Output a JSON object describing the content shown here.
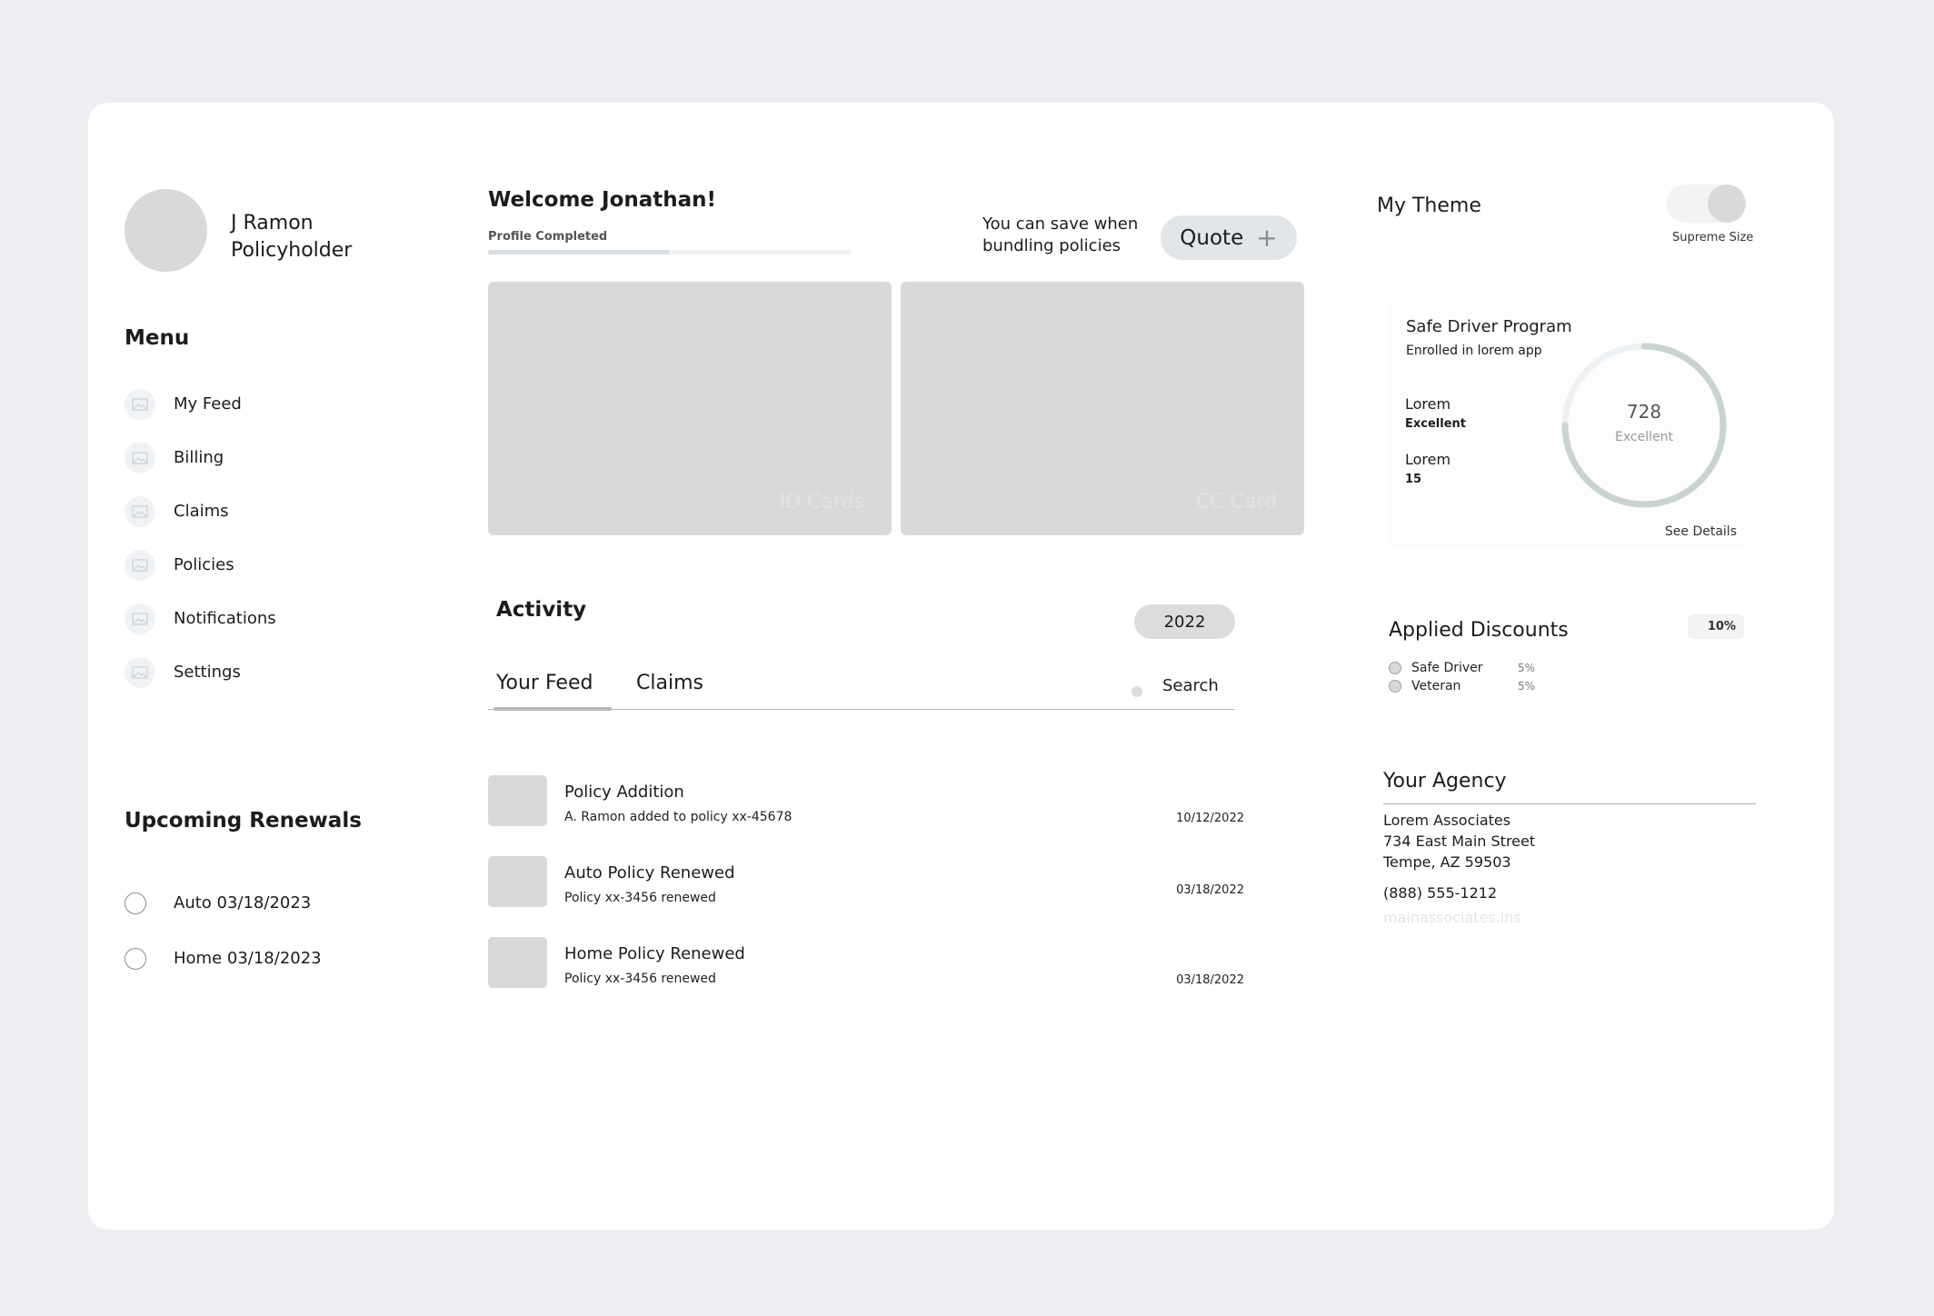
{
  "profile": {
    "name": "J Ramon",
    "role": "Policyholder"
  },
  "menu": {
    "heading": "Menu",
    "items": [
      {
        "label": "My Feed",
        "icon": "image-icon"
      },
      {
        "label": "Billing",
        "icon": "image-icon"
      },
      {
        "label": "Claims",
        "icon": "image-icon"
      },
      {
        "label": "Policies",
        "icon": "image-icon"
      },
      {
        "label": "Notifications",
        "icon": "image-icon"
      },
      {
        "label": "Settings",
        "icon": "image-icon"
      }
    ]
  },
  "renewals": {
    "heading": "Upcoming Renewals",
    "items": [
      "Auto 03/18/2023",
      "Home 03/18/2023"
    ]
  },
  "welcome": {
    "title": "Welcome Jonathan!",
    "progress_label": "Profile Completed",
    "progress_fraction": 0.5
  },
  "bundle": {
    "text": "You can save when bundling policies",
    "quote_label": "Quote",
    "quote_icon": "plus-icon"
  },
  "cards": [
    {
      "label": "ID Cards"
    },
    {
      "label": "CC Card"
    }
  ],
  "activity": {
    "heading": "Activity",
    "year": "2022",
    "tabs": [
      "Your Feed",
      "Claims"
    ],
    "search_label": "Search",
    "feed": [
      {
        "title": "Policy Addition",
        "subtitle": "A. Ramon added to policy xx-45678",
        "date": "10/12/2022"
      },
      {
        "title": "Auto Policy Renewed",
        "subtitle": "Policy xx-3456 renewed",
        "date": "03/18/2022"
      },
      {
        "title": "Home Policy Renewed",
        "subtitle": "Policy xx-3456 renewed",
        "date": "03/18/2022"
      }
    ]
  },
  "theme": {
    "label": "My Theme",
    "caption": "Supreme Size"
  },
  "safe_driver": {
    "title": "Safe Driver Program",
    "subtitle": "Enrolled in lorem app",
    "stats": [
      {
        "label": "Lorem",
        "value": "Excellent"
      },
      {
        "label": "Lorem",
        "value": "15"
      }
    ],
    "score": "728",
    "score_label": "Excellent",
    "ring_fraction": 0.75,
    "details_label": "See Details",
    "colors": {
      "ring_fill": "#c9d4cf",
      "ring_track": "#eef1f4"
    }
  },
  "discounts": {
    "heading": "Applied Discounts",
    "total": "10%",
    "items": [
      {
        "name": "Safe Driver",
        "percent": "5%"
      },
      {
        "name": "Veteran",
        "percent": "5%"
      }
    ]
  },
  "agency": {
    "heading": "Your Agency",
    "name": "Lorem Associates",
    "street": "734 East Main Street",
    "city": "Tempe, AZ 59503",
    "phone": "(888) 555-1212",
    "website": "mainassociates.ins"
  }
}
